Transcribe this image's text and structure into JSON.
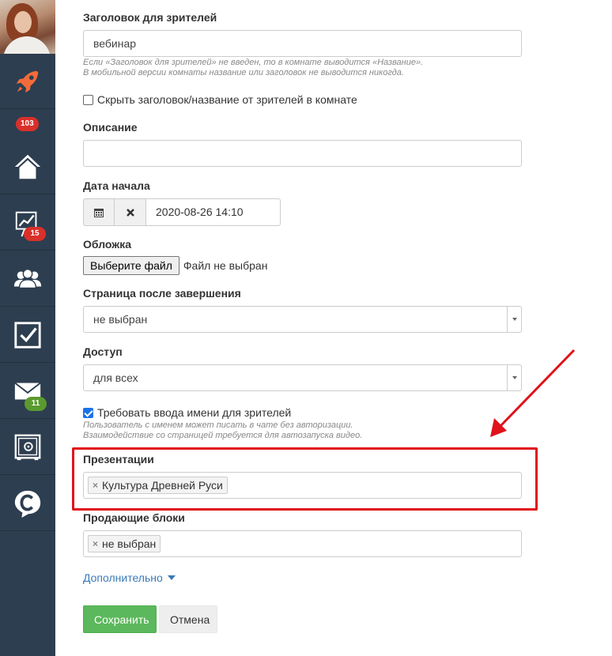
{
  "sidebar": {
    "items": [
      {
        "icon": "rocket-icon",
        "badge": null
      },
      {
        "icon": "home-icon",
        "badge": "103",
        "badge_color": "red"
      },
      {
        "icon": "chart-icon",
        "badge": "15",
        "badge_color": "red"
      },
      {
        "icon": "users-icon",
        "badge": null
      },
      {
        "icon": "checkbox-icon",
        "badge": null
      },
      {
        "icon": "mail-icon",
        "badge": "11",
        "badge_color": "green"
      },
      {
        "icon": "safe-icon",
        "badge": null
      },
      {
        "icon": "chat-c-icon",
        "badge": null
      }
    ],
    "accent": "#f26b3a",
    "bg": "#2d3e50"
  },
  "form": {
    "viewer_title": {
      "label": "Заголовок для зрителей",
      "value": "вебинар",
      "hint1": "Если «Заголовок для зрителей» не введен, то в комнате выводится «Название».",
      "hint2": "В мобильной версии комнаты название или заголовок не выводится никогда."
    },
    "hide_title": {
      "label": "Скрыть заголовок/название от зрителей в комнате",
      "checked": false
    },
    "description": {
      "label": "Описание",
      "value": ""
    },
    "start_date": {
      "label": "Дата начала",
      "value": "2020-08-26 14:10"
    },
    "cover": {
      "label": "Обложка",
      "button": "Выберите файл",
      "status": "Файл не выбран"
    },
    "after_page": {
      "label": "Страница после завершения",
      "value": "не выбран"
    },
    "access": {
      "label": "Доступ",
      "value": "для всех"
    },
    "require_name": {
      "label": "Требовать ввода имени для зрителей",
      "checked": true,
      "hint1": "Пользователь с именем может писать в чате без авторизации.",
      "hint2": "Взаимодействие со страницей требуется для автозапуска видео."
    },
    "presentations": {
      "label": "Презентации",
      "tag": "Культура Древней Руси"
    },
    "selling_blocks": {
      "label": "Продающие блоки",
      "tag": "не выбран"
    },
    "more": "Дополнительно",
    "save": "Сохранить",
    "cancel": "Отмена"
  },
  "colors": {
    "save": "#5cb85c",
    "highlight": "#e0121a",
    "link": "#3a7ab8"
  }
}
